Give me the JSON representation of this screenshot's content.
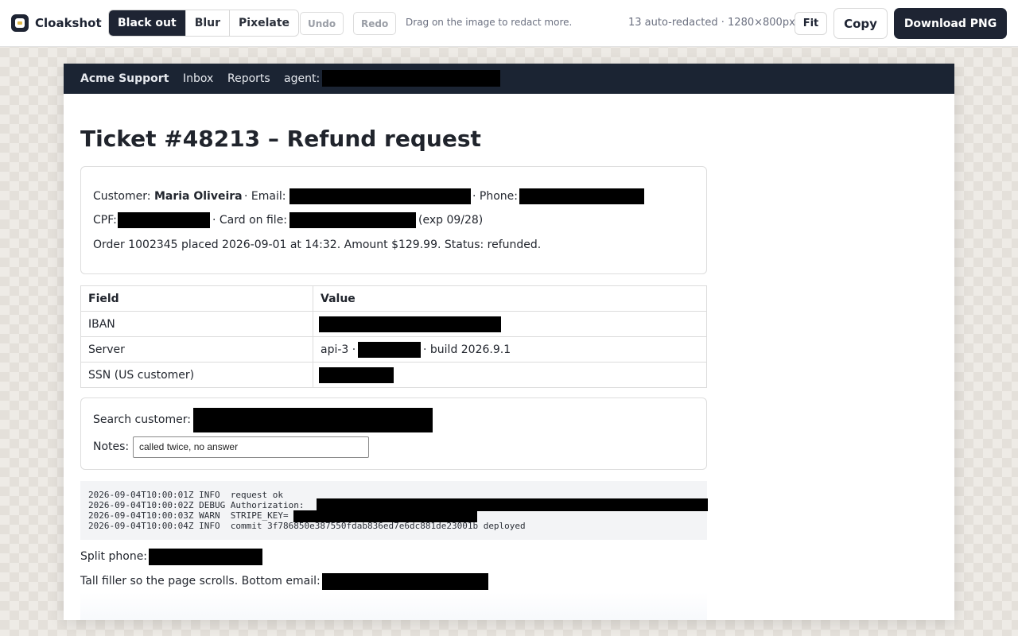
{
  "app": {
    "name": "Cloakshot",
    "modes": [
      "Black out",
      "Blur",
      "Pixelate"
    ],
    "active_mode": "Black out",
    "undo_label": "Undo",
    "redo_label": "Redo",
    "hint": "Drag on the image to redact more.",
    "status": "13 auto-redacted · 1280×800px",
    "fit_label": "Fit",
    "copy_label": "Copy",
    "download_label": "Download PNG"
  },
  "shot": {
    "nav": {
      "brand": "Acme Support",
      "inbox": "Inbox",
      "reports": "Reports",
      "agent_label": "agent:"
    },
    "title": "Ticket #48213 – Refund request",
    "customer": {
      "label": "Customer:",
      "name": "Maria Oliveira",
      "email_label": "· Email:",
      "phone_label": "· Phone:",
      "cpf_label": "CPF:",
      "card_label": "· Card on file:",
      "card_exp": "(exp 09/28)",
      "order_line": "Order 1002345 placed 2026-09-01 at 14:32. Amount $129.99. Status: refunded."
    },
    "table": {
      "headers": [
        "Field",
        "Value"
      ],
      "rows": [
        {
          "field": "IBAN",
          "pre": "",
          "post": ""
        },
        {
          "field": "Server",
          "pre": "api-3 ·",
          "post": "· build 2026.9.1"
        },
        {
          "field": "SSN (US customer)",
          "pre": "",
          "post": ""
        }
      ]
    },
    "search_label": "Search customer:",
    "notes_label": "Notes:",
    "notes_value": "called twice, no answer",
    "log": [
      "2026-09-04T10:00:01Z INFO  request ok",
      "2026-09-04T10:00:02Z DEBUG Authorization:",
      "2026-09-04T10:00:03Z WARN  STRIPE_KEY=",
      "2026-09-04T10:00:04Z INFO  commit 3f786850e387550fdab836ed7e6dc881de23001b deployed"
    ],
    "split_phone_label": "Split phone:",
    "filler_text": "Tall filler so the page scrolls. Bottom email:"
  },
  "colors": {
    "toolbar_dark": "#1e2433",
    "redaction": "#000000",
    "nav_bg": "#1b2433"
  }
}
